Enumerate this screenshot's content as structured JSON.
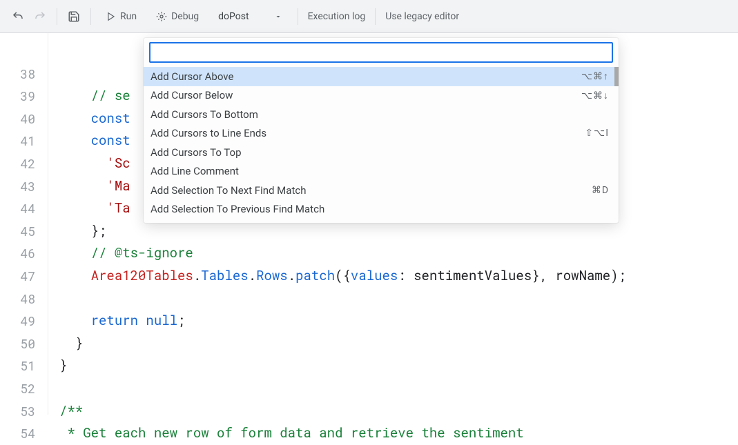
{
  "toolbar": {
    "run": "Run",
    "debug": "Debug",
    "funcSelect": "doPost",
    "execLog": "Execution log",
    "legacy": "Use legacy editor"
  },
  "gutter": [
    "",
    "38",
    "39",
    "40",
    "41",
    "42",
    "43",
    "44",
    "45",
    "46",
    "47",
    "48",
    "49",
    "50",
    "51",
    "52",
    "53",
    "54"
  ],
  "code": {
    "l39_comment": "// se",
    "l40_const": "const",
    "l41_const": "const",
    "l42_str": "'Sc",
    "l43_str": "'Ma",
    "l44_str": "'Ta",
    "l45": "};",
    "l46_comment": "// @ts-ignore",
    "l47_a": "Area120Tables",
    "l47_b": ".",
    "l47_c": "Tables",
    "l47_d": ".",
    "l47_e": "Rows",
    "l47_f": ".",
    "l47_g": "patch",
    "l47_h": "({",
    "l47_i": "values",
    "l47_j": ": sentimentValues}, rowName);",
    "l49_return": "return",
    "l49_null": " null",
    "l49_semi": ";",
    "l50": "}",
    "l51": "}",
    "l53": "/**",
    "l54": " * Get each new row of form data and retrieve the sentiment "
  },
  "palette": {
    "items": [
      {
        "label": "Add Cursor Above",
        "shortcut": "⌥⌘↑",
        "selected": true
      },
      {
        "label": "Add Cursor Below",
        "shortcut": "⌥⌘↓"
      },
      {
        "label": "Add Cursors To Bottom",
        "shortcut": ""
      },
      {
        "label": "Add Cursors to Line Ends",
        "shortcut": "⇧⌥I"
      },
      {
        "label": "Add Cursors To Top",
        "shortcut": ""
      },
      {
        "label": "Add Line Comment",
        "shortcut": ""
      },
      {
        "label": "Add Selection To Next Find Match",
        "shortcut": "⌘D"
      },
      {
        "label": "Add Selection To Previous Find Match",
        "shortcut": ""
      }
    ]
  }
}
